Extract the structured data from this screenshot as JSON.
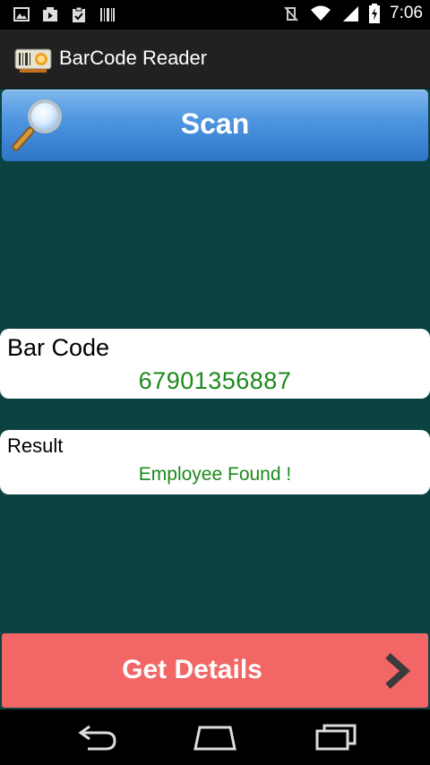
{
  "status_bar": {
    "time": "7:06",
    "left_icons": [
      "gallery-icon",
      "video-icon",
      "clipboard-check-icon",
      "barcode-icon"
    ],
    "right_icons": [
      "vibrate-off-icon",
      "wifi-icon",
      "signal-icon",
      "battery-charging-icon"
    ]
  },
  "action_bar": {
    "title": "BarCode Reader",
    "icon": "barcode-scanner-icon"
  },
  "scan_button": {
    "label": "Scan",
    "icon": "magnifier-icon"
  },
  "barcode_card": {
    "label": "Bar Code",
    "value": "67901356887"
  },
  "result_card": {
    "label": "Result",
    "value": "Employee Found !"
  },
  "details_button": {
    "label": "Get Details",
    "icon": "chevron-right-icon"
  },
  "nav_bar": {
    "icons": [
      "back-icon",
      "home-icon",
      "recent-apps-icon"
    ]
  },
  "colors": {
    "background": "#0b4242",
    "scan_button": "#4c94df",
    "details_button": "#f26666",
    "value_text": "#1b8a1b",
    "action_bar": "#212121"
  }
}
